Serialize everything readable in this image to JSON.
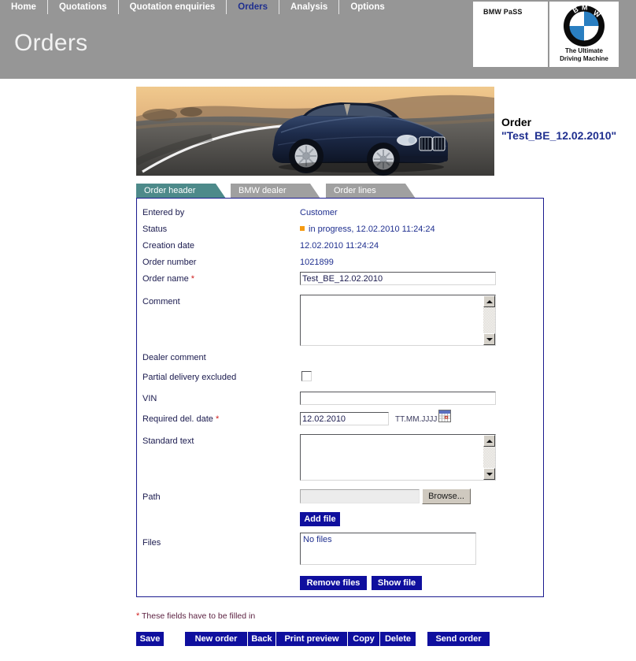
{
  "topnav": {
    "items": [
      {
        "label": "Home",
        "active": false
      },
      {
        "label": "Quotations",
        "active": false
      },
      {
        "label": "Quotation enquiries",
        "active": false
      },
      {
        "label": "Orders",
        "active": true
      },
      {
        "label": "Analysis",
        "active": false
      },
      {
        "label": "Options",
        "active": false
      }
    ]
  },
  "header": {
    "page_title": "Orders",
    "app_name": "BMW PaSS",
    "brand_tagline_line1": "The Ultimate",
    "brand_tagline_line2": "Driving Machine",
    "bar_color": "#969696"
  },
  "order": {
    "heading": "Order",
    "name_quoted": "\"Test_BE_12.02.2010\""
  },
  "tabs": [
    {
      "label": "Order header",
      "active": true
    },
    {
      "label": "BMW dealer",
      "active": false
    },
    {
      "label": "Order lines",
      "active": false
    }
  ],
  "form": {
    "entered_by": {
      "label": "Entered by",
      "value": "Customer"
    },
    "status": {
      "label": "Status",
      "value": "in progress, 12.02.2010 11:24:24",
      "indicator_color": "#f59a12"
    },
    "creation_date": {
      "label": "Creation date",
      "value": "12.02.2010 11:24:24"
    },
    "order_number": {
      "label": "Order number",
      "value": "1021899"
    },
    "order_name": {
      "label": "Order name",
      "required": "*",
      "value": "Test_BE_12.02.2010"
    },
    "comment": {
      "label": "Comment",
      "value": ""
    },
    "dealer_comment": {
      "label": "Dealer comment",
      "value": ""
    },
    "partial_delivery": {
      "label": "Partial delivery excluded",
      "checked": false
    },
    "vin": {
      "label": "VIN",
      "value": ""
    },
    "required_del_date": {
      "label": "Required del. date",
      "required": "*",
      "value": "12.02.2010",
      "format_hint": "TT.MM.JJJJ"
    },
    "standard_text": {
      "label": "Standard text",
      "value": ""
    },
    "path": {
      "label": "Path",
      "value": "",
      "browse_label": "Browse..."
    },
    "add_file_label": "Add file",
    "files": {
      "label": "Files",
      "empty_text": "No files"
    },
    "remove_files_label": "Remove files",
    "show_file_label": "Show file"
  },
  "footnote": {
    "asterisk": "*",
    "text": "These fields have to be filled in"
  },
  "actions": [
    {
      "label": "Save"
    },
    {
      "label": "New order"
    },
    {
      "label": "Back"
    },
    {
      "label": "Print preview"
    },
    {
      "label": "Copy"
    },
    {
      "label": "Delete"
    },
    {
      "label": "Send order"
    }
  ],
  "colors": {
    "tab_active": "#4d8a8a",
    "tab_inactive": "#a0a0a0",
    "button_blue": "#0f0f9e",
    "panel_border": "#1b1b8f",
    "link_blue": "#1f2f8f"
  }
}
